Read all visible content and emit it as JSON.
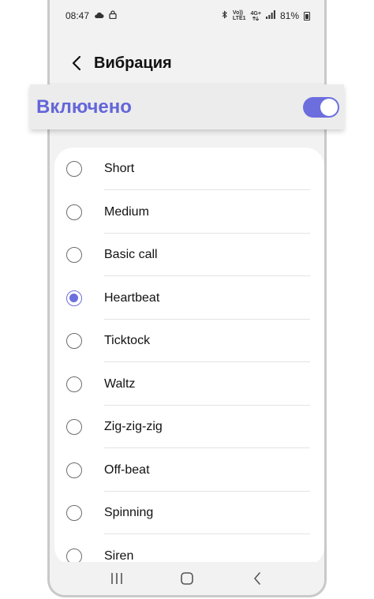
{
  "status_bar": {
    "time": "08:47",
    "network_top": "Vo))",
    "network_bottom": "LTE1",
    "network_type": "4G+",
    "battery": "81%"
  },
  "header": {
    "title": "Вибрация"
  },
  "toggle": {
    "label": "Включено",
    "state": "on"
  },
  "patterns": [
    {
      "label": "Short",
      "selected": false
    },
    {
      "label": "Medium",
      "selected": false
    },
    {
      "label": "Basic call",
      "selected": false
    },
    {
      "label": "Heartbeat",
      "selected": true
    },
    {
      "label": "Ticktock",
      "selected": false
    },
    {
      "label": "Waltz",
      "selected": false
    },
    {
      "label": "Zig-zig-zig",
      "selected": false
    },
    {
      "label": "Off-beat",
      "selected": false
    },
    {
      "label": "Spinning",
      "selected": false
    },
    {
      "label": "Siren",
      "selected": false
    }
  ],
  "colors": {
    "accent": "#6c6ede",
    "screen_bg": "#f2f2f2",
    "card_bg": "#ffffff"
  }
}
